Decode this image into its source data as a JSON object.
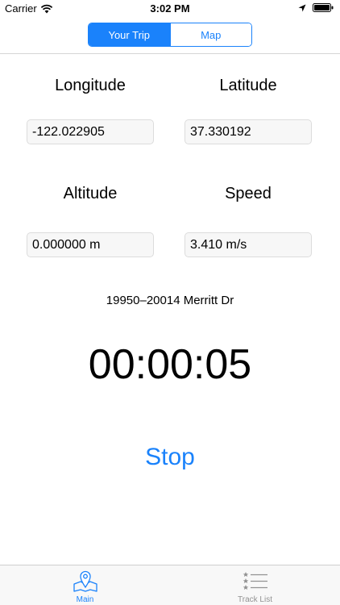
{
  "status_bar": {
    "carrier": "Carrier",
    "time": "3:02 PM",
    "icons": [
      "wifi-icon",
      "location-arrow-icon",
      "battery-icon"
    ]
  },
  "segmented_control": {
    "segments": [
      {
        "label": "Your Trip",
        "selected": true
      },
      {
        "label": "Map",
        "selected": false
      }
    ]
  },
  "fields": {
    "longitude": {
      "label": "Longitude",
      "value": "-122.022905"
    },
    "latitude": {
      "label": "Latitude",
      "value": "37.330192"
    },
    "altitude": {
      "label": "Altitude",
      "value": "0.000000 m"
    },
    "speed": {
      "label": "Speed",
      "value": "3.410 m/s"
    }
  },
  "address": "19950–20014 Merritt Dr",
  "timer": "00:00:05",
  "stop_label": "Stop",
  "tab_bar": {
    "items": [
      {
        "label": "Main",
        "icon": "map-pin-icon",
        "active": true
      },
      {
        "label": "Track List",
        "icon": "starred-list-icon",
        "active": false
      }
    ]
  },
  "colors": {
    "accent": "#1a82fb",
    "field_background": "#f7f7f7",
    "tab_inactive": "#929292"
  }
}
